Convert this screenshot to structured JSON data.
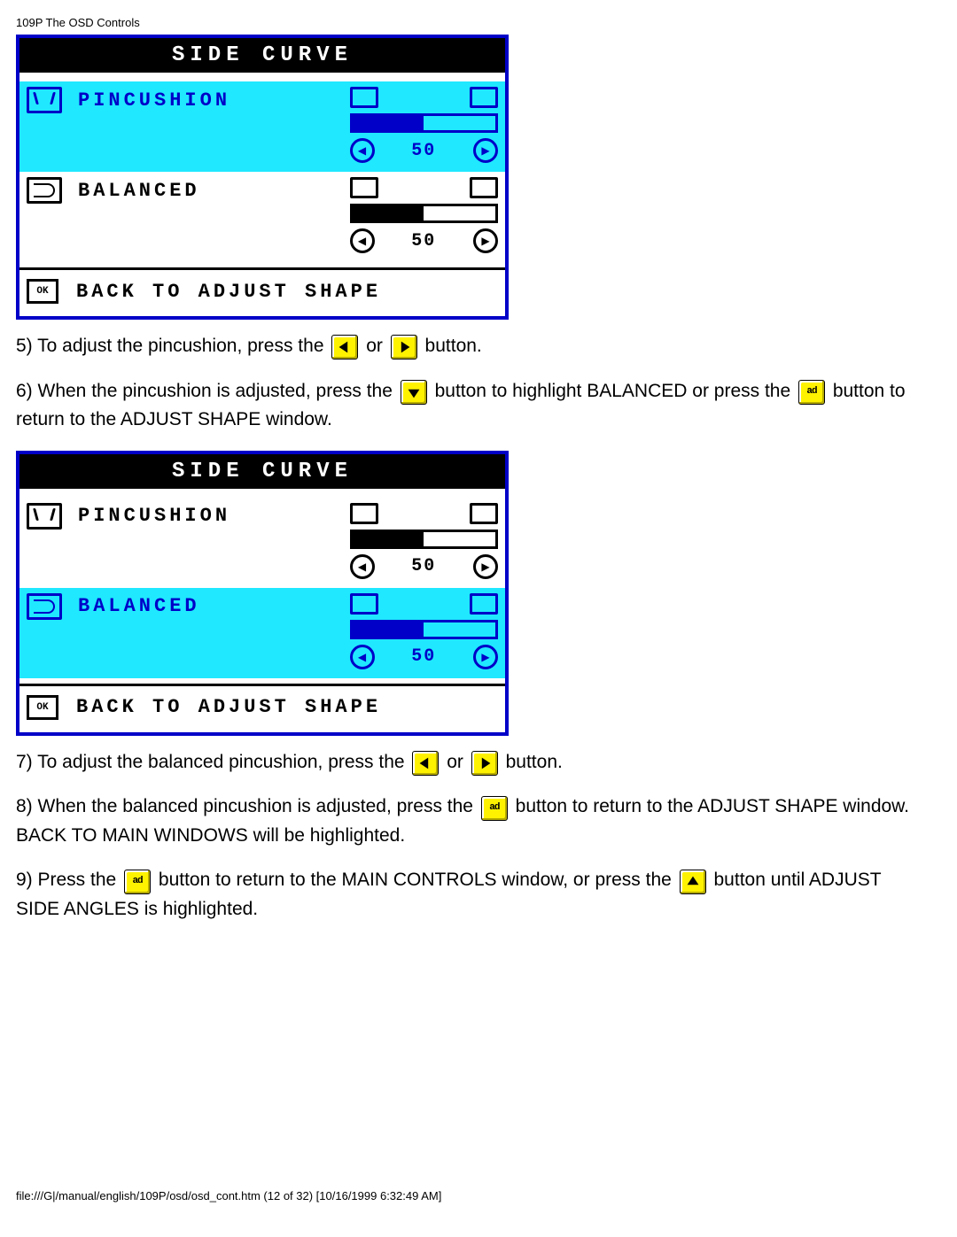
{
  "header": "109P The OSD Controls",
  "osd1": {
    "title": "SIDE CURVE",
    "rows": [
      {
        "label": "PINCUSHION",
        "value": "50",
        "selected": true,
        "icon": "pinc"
      },
      {
        "label": "BALANCED",
        "value": "50",
        "selected": false,
        "icon": "bal"
      }
    ],
    "footer_ok": "OK",
    "footer": "BACK TO ADJUST SHAPE"
  },
  "osd2": {
    "title": "SIDE CURVE",
    "rows": [
      {
        "label": "PINCUSHION",
        "value": "50",
        "selected": false,
        "icon": "pinc"
      },
      {
        "label": "BALANCED",
        "value": "50",
        "selected": true,
        "icon": "bal"
      }
    ],
    "footer_ok": "OK",
    "footer": "BACK TO ADJUST SHAPE"
  },
  "p5a": "5) To adjust the pincushion, press the ",
  "p5b": " or ",
  "p5c": " button.",
  "p6a": "6) When the pincushion is adjusted, press the ",
  "p6b": " button to highlight BALANCED or press the ",
  "p6c": " button to return to the ADJUST SHAPE window.",
  "p7a": "7) To adjust the balanced pincushion, press the ",
  "p7b": " or ",
  "p7c": " button.",
  "p8a": "8) When the balanced pincushion is adjusted, press the ",
  "p8b": " button to return to the ADJUST SHAPE window. BACK TO MAIN WINDOWS will be highlighted.",
  "p9a": "9) Press the ",
  "p9b": " button to return to the MAIN CONTROLS window, or press the ",
  "p9c": " button until ADJUST SIDE ANGLES is highlighted.",
  "btn_ad_label": "ad",
  "footer_line": "file:///G|/manual/english/109P/osd/osd_cont.htm (12 of 32) [10/16/1999 6:32:49 AM]"
}
